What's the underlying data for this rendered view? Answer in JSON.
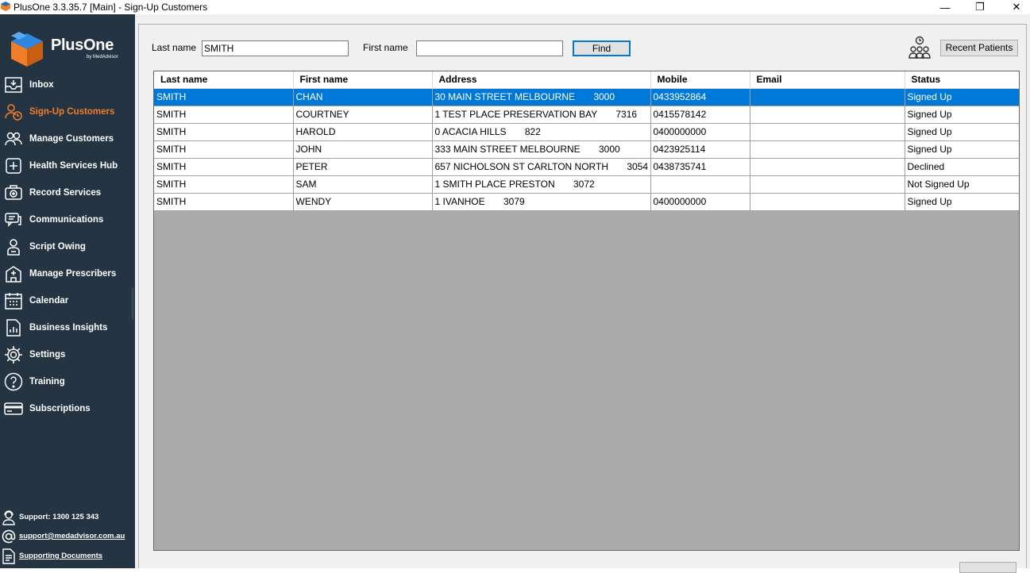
{
  "window": {
    "title": "PlusOne 3.3.35.7 [Main] - Sign-Up Customers",
    "minimize": "—",
    "restore": "❐",
    "close": "✕"
  },
  "logo": {
    "brand": "PlusOne",
    "sub": "by MedAdvisor"
  },
  "sidebar": {
    "items": [
      {
        "label": "Inbox",
        "icon": "inbox-icon"
      },
      {
        "label": "Sign-Up Customers",
        "icon": "sign-up-icon",
        "active": true
      },
      {
        "label": "Manage Customers",
        "icon": "customers-icon"
      },
      {
        "label": "Health Services Hub",
        "icon": "health-hub-icon"
      },
      {
        "label": "Record Services",
        "icon": "record-services-icon"
      },
      {
        "label": "Communications",
        "icon": "communications-icon"
      },
      {
        "label": "Script Owing",
        "icon": "script-owing-icon"
      },
      {
        "label": "Manage Prescribers",
        "icon": "prescribers-icon"
      },
      {
        "label": "Calendar",
        "icon": "calendar-icon"
      },
      {
        "label": "Business Insights",
        "icon": "insights-icon"
      },
      {
        "label": "Settings",
        "icon": "gear-icon"
      },
      {
        "label": "Training",
        "icon": "help-icon"
      },
      {
        "label": "Subscriptions",
        "icon": "card-icon"
      }
    ],
    "footer": {
      "support": "Support: 1300 125 343",
      "email": "support@medadvisor.com.au",
      "docs": "Supporting Documents"
    }
  },
  "search": {
    "last_name_label": "Last name",
    "last_name_value": "SMITH",
    "first_name_label": "First name",
    "first_name_value": "",
    "find_label": "Find",
    "recent_label": "Recent Patients"
  },
  "table": {
    "columns": [
      "Last name",
      "First name",
      "Address",
      "Mobile",
      "Email",
      "Status"
    ],
    "rows": [
      [
        "SMITH",
        "CHAN",
        "30 MAIN STREET MELBOURNE       3000",
        "0433952864",
        "",
        "Signed Up"
      ],
      [
        "SMITH",
        "COURTNEY",
        "1 TEST PLACE PRESERVATION BAY       7316",
        "0415578142",
        "",
        "Signed Up"
      ],
      [
        "SMITH",
        "HAROLD",
        "0 ACACIA HILLS       822",
        "0400000000",
        "",
        "Signed Up"
      ],
      [
        "SMITH",
        "JOHN",
        "333 MAIN STREET MELBOURNE       3000",
        "0423925114",
        "",
        "Signed Up"
      ],
      [
        "SMITH",
        "PETER",
        "657 NICHOLSON ST CARLTON NORTH       3054",
        "0438735741",
        "",
        "Declined"
      ],
      [
        "SMITH",
        "SAM",
        "1 SMITH PLACE PRESTON       3072",
        "",
        "",
        "Not Signed Up"
      ],
      [
        "SMITH",
        "WENDY",
        "1 IVANHOE       3079",
        "0400000000",
        "",
        "Signed Up"
      ]
    ],
    "selected_row": 0
  },
  "colors": {
    "sidebar": "#243443",
    "accent": "#f07d2a",
    "selection": "#0078d7"
  }
}
